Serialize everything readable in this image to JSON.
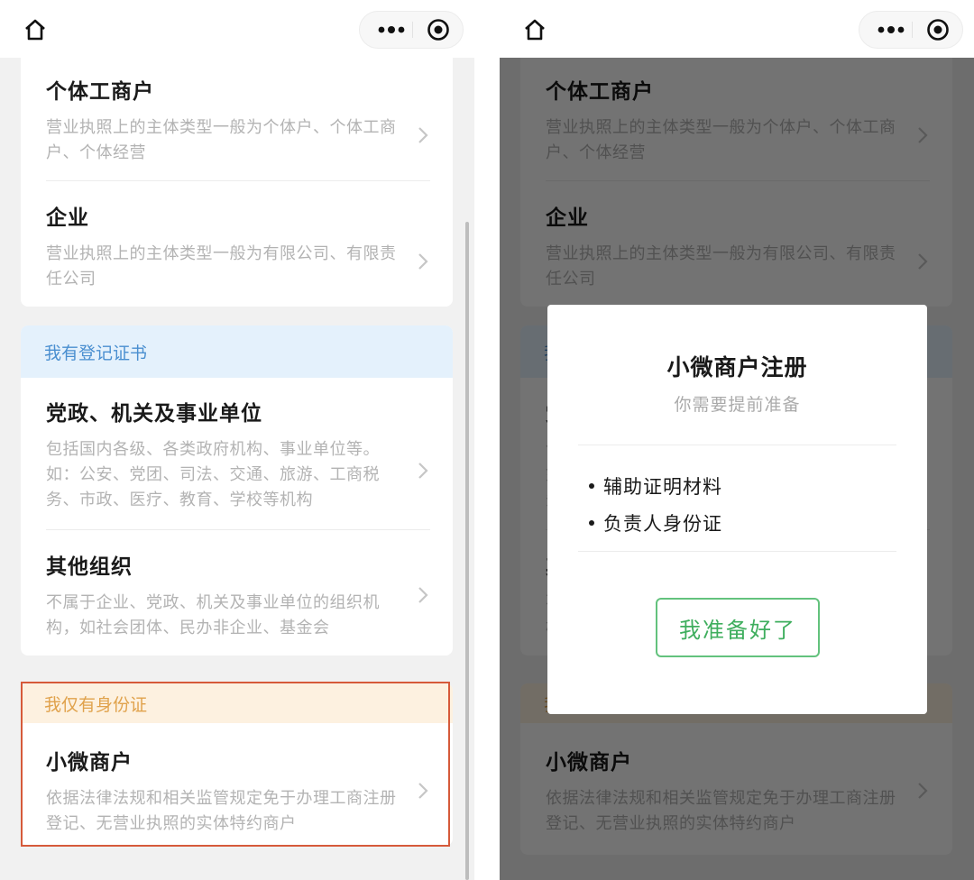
{
  "screens": [
    {
      "header": {
        "home_icon": "home-icon",
        "more_icon": "more-dots-icon",
        "close_icon": "record-close-icon"
      },
      "section1": {
        "items": [
          {
            "title": "个体工商户",
            "desc": "营业执照上的主体类型一般为个体户、个体工商户、个体经营"
          },
          {
            "title": "企业",
            "desc": "营业执照上的主体类型一般为有限公司、有限责任公司"
          }
        ]
      },
      "section2": {
        "header": "我有登记证书",
        "items": [
          {
            "title": "党政、机关及事业单位",
            "desc": "包括国内各级、各类政府机构、事业单位等。如：公安、党团、司法、交通、旅游、工商税务、市政、医疗、教育、学校等机构"
          },
          {
            "title": "其他组织",
            "desc": "不属于企业、党政、机关及事业单位的组织机构，如社会团体、民办非企业、基金会"
          }
        ]
      },
      "section3": {
        "header": "我仅有身份证",
        "items": [
          {
            "title": "小微商户",
            "desc": "依据法律法规和相关监管规定免于办理工商注册登记、无营业执照的实体特约商户"
          }
        ]
      }
    }
  ],
  "dialog": {
    "title": "小微商户注册",
    "subtitle": "你需要提前准备",
    "items": [
      "辅助证明材料",
      "负责人身份证"
    ],
    "confirm_label": "我准备好了"
  },
  "colors": {
    "highlight_border": "#d65a3a",
    "section_blue_text": "#4a8fd0",
    "section_orange_text": "#e0a24c",
    "confirm_green": "#3fae5e"
  }
}
